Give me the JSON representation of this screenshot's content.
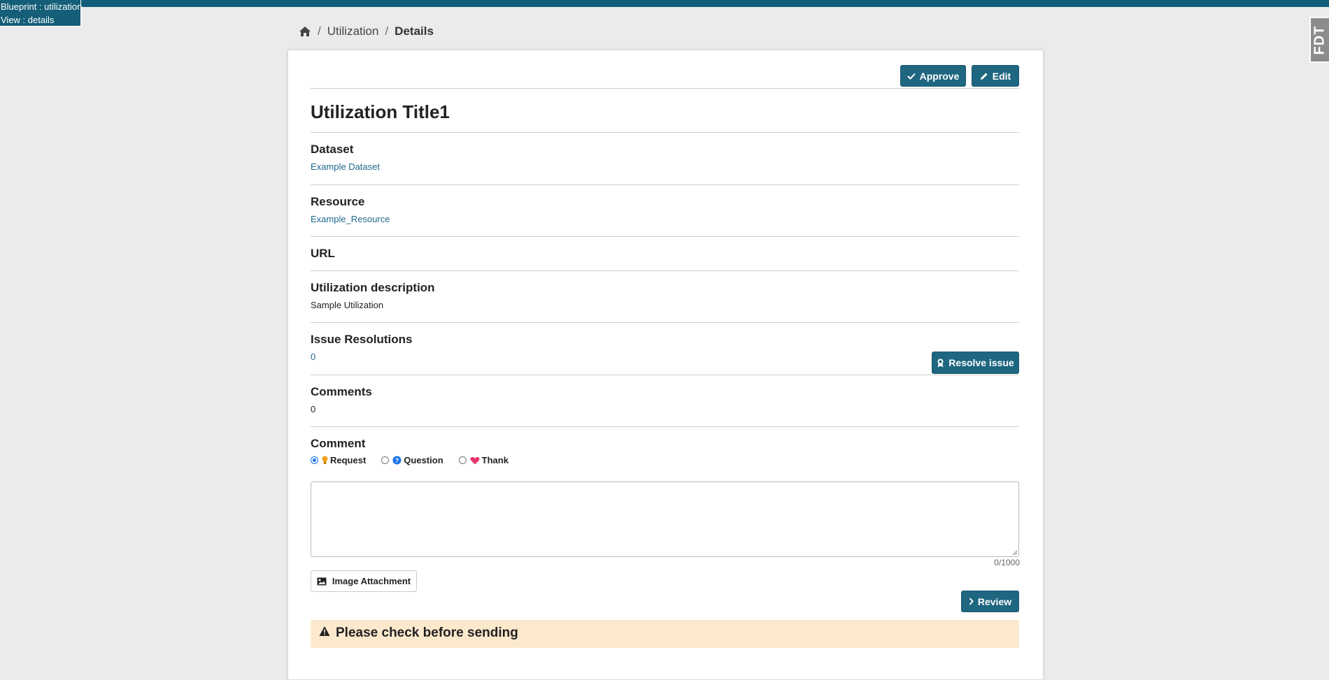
{
  "debug": {
    "blueprint": "Blueprint : utilization",
    "view": "View : details"
  },
  "fdt_tab": "FDT",
  "breadcrumb": {
    "items": [
      "Utilization",
      "Details"
    ]
  },
  "actions": {
    "approve": "Approve",
    "edit": "Edit"
  },
  "title": "Utilization Title1",
  "sections": {
    "dataset": {
      "label": "Dataset",
      "value": "Example Dataset"
    },
    "resource": {
      "label": "Resource",
      "value": "Example_Resource"
    },
    "url": {
      "label": "URL"
    },
    "description": {
      "label": "Utilization description",
      "value": "Sample Utilization"
    },
    "issue_resolutions": {
      "label": "Issue Resolutions",
      "value": "0",
      "button": "Resolve issue"
    },
    "comments": {
      "label": "Comments",
      "value": "0"
    }
  },
  "comment_form": {
    "label": "Comment",
    "categories": [
      {
        "label": "Request",
        "icon": "lightbulb-icon",
        "selected": true
      },
      {
        "label": "Question",
        "icon": "question-circle-icon",
        "selected": false
      },
      {
        "label": "Thank",
        "icon": "heart-icon",
        "selected": false
      }
    ],
    "textarea_value": "",
    "counter": "0/1000",
    "image_attachment": "Image Attachment",
    "review": "Review"
  },
  "alert": {
    "text": "Please check before sending"
  },
  "colors": {
    "primary": "#1f6680",
    "link": "#1f6a8e",
    "alert_bg": "#fce9cd",
    "heart": "#e8336b",
    "bulb": "#f0a21e",
    "question": "#1a73e8"
  }
}
